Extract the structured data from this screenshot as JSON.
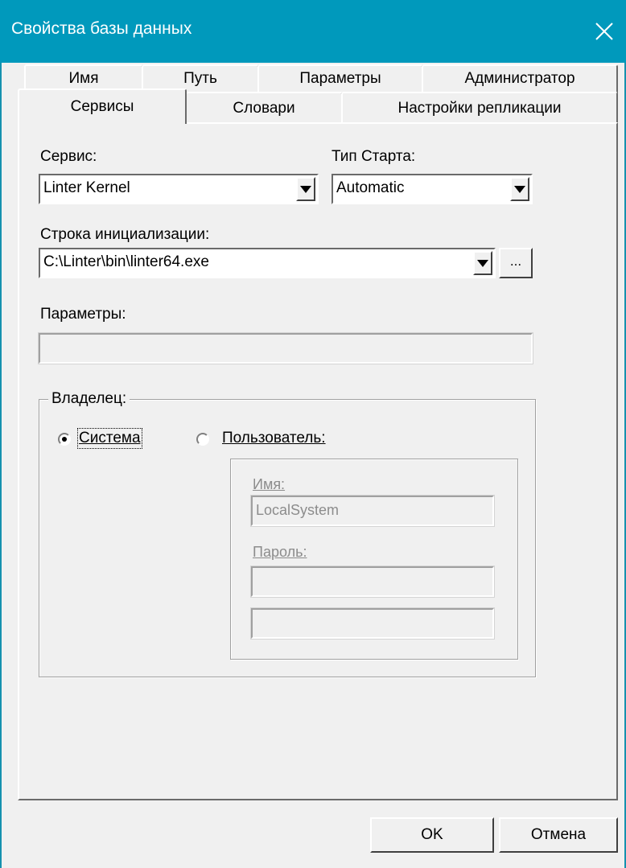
{
  "window": {
    "title": "Свойства базы данных"
  },
  "tabs": {
    "row1": [
      "Имя",
      "Путь",
      "Параметры",
      "Администратор"
    ],
    "row2": [
      "Сервисы",
      "Словари",
      "Настройки репликации"
    ],
    "active": "Сервисы"
  },
  "service": {
    "label": "Сервис:",
    "value": "Linter Kernel"
  },
  "start_type": {
    "label": "Тип Старта:",
    "value": "Automatic"
  },
  "init_string": {
    "label": "Строка инициализации:",
    "value": "C:\\Linter\\bin\\linter64.exe",
    "browse_label": "..."
  },
  "params": {
    "label": "Параметры:",
    "value": ""
  },
  "owner": {
    "group_label": "Владелец:",
    "system_label": "Система",
    "user_label": "Пользователь:",
    "selected": "Система",
    "name_label": "Имя:",
    "name_value": "LocalSystem",
    "password_label": "Пароль:"
  },
  "buttons": {
    "ok": "OK",
    "cancel": "Отмена"
  },
  "colors": {
    "titlebar": "#0099bc",
    "background": "#f0f0f0"
  }
}
